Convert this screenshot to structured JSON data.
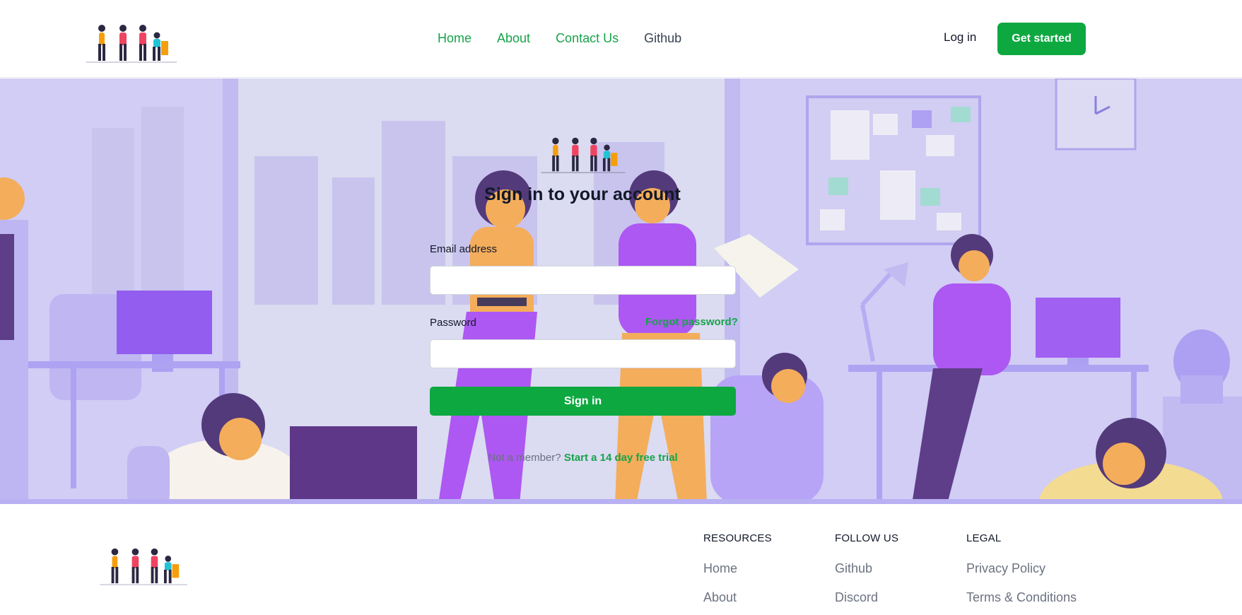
{
  "header": {
    "nav": [
      {
        "label": "Home"
      },
      {
        "label": "About"
      },
      {
        "label": "Contact Us"
      },
      {
        "label": "Github"
      }
    ],
    "login_label": "Log in",
    "cta_label": "Get started"
  },
  "signin_form": {
    "title": "Sign in to your account",
    "email_label": "Email address",
    "email_value": "",
    "password_label": "Password",
    "password_value": "",
    "forgot_label": "Forgot password?",
    "submit_label": "Sign in",
    "not_member_text": "Not a member?",
    "trial_link": "Start a 14 day free trial"
  },
  "footer": {
    "columns": [
      {
        "heading": "RESOURCES",
        "links": [
          "Home",
          "About"
        ]
      },
      {
        "heading": "FOLLOW US",
        "links": [
          "Github",
          "Discord"
        ]
      },
      {
        "heading": "LEGAL",
        "links": [
          "Privacy Policy",
          "Terms & Conditions"
        ]
      }
    ]
  },
  "colors": {
    "brand_green": "#0ea841",
    "link_green": "#16a34a",
    "hero_bg": "#c7c3f3"
  },
  "icons": {
    "logo": "team-illustration-logo",
    "hero": "office-team-illustration"
  }
}
